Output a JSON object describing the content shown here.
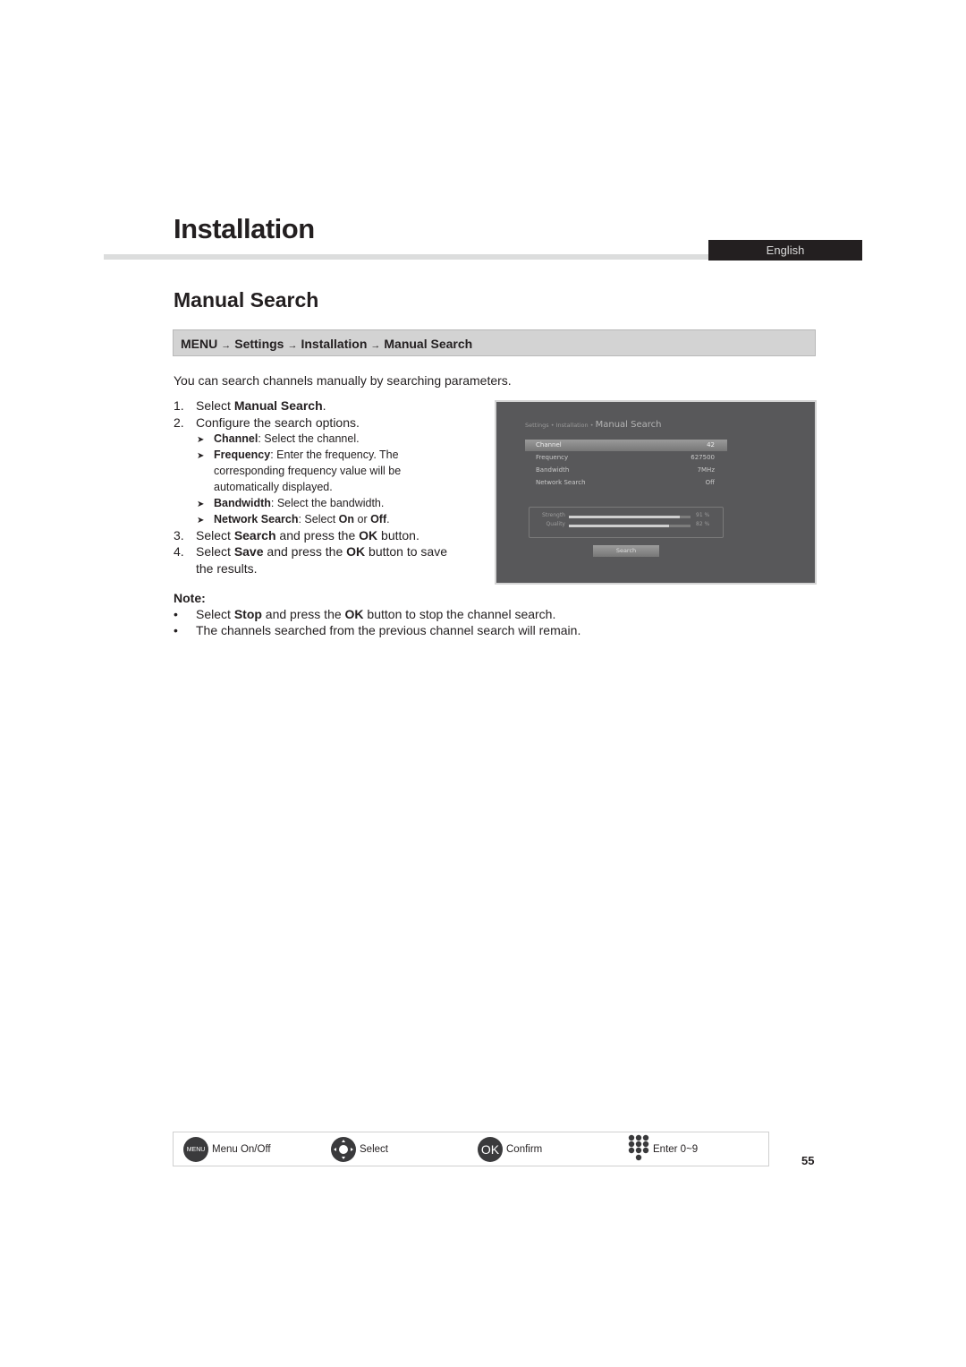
{
  "header": {
    "chapter_title": "Installation",
    "language_tab": "English"
  },
  "section": {
    "title": "Manual Search",
    "path": [
      "MENU",
      "Settings",
      "Installation",
      "Manual Search"
    ],
    "path_separator": "→",
    "intro": "You can search channels manually by searching parameters."
  },
  "steps": [
    {
      "num": "1.",
      "pre": "Select ",
      "bold": "Manual Search",
      "post": "."
    },
    {
      "num": "2.",
      "text": "Configure the search options."
    },
    {
      "num": "3.",
      "pre": "Select ",
      "bold": "Search",
      "mid": " and press the ",
      "bold2": "OK",
      "post": " button."
    },
    {
      "num": "4.",
      "pre": "Select ",
      "bold": "Save",
      "mid": " and press the ",
      "bold2": "OK",
      "post": " button to save",
      "cont": "the results."
    }
  ],
  "options": [
    {
      "bullet": "➤",
      "bold": "Channel",
      "text": ": Select the channel."
    },
    {
      "bullet": "➤",
      "bold": "Frequency",
      "text": ": Enter the frequency. The",
      "cont1": "corresponding frequency value will be",
      "cont2": "automatically displayed."
    },
    {
      "bullet": "➤",
      "bold": "Bandwidth",
      "text": ": Select the bandwidth."
    },
    {
      "bullet": "➤",
      "bold": "Network Search",
      "text": ": Select ",
      "bold2": "On",
      "mid": " or ",
      "bold3": "Off",
      "post": "."
    }
  ],
  "tv_screen": {
    "breadcrumb": "Settings • Installation •",
    "title": "Manual Search",
    "rows": [
      {
        "label": "Channel",
        "value": "42",
        "selected": true
      },
      {
        "label": "Frequency",
        "value": "627500"
      },
      {
        "label": "Bandwidth",
        "value": "7MHz"
      },
      {
        "label": "Network Search",
        "value": "Off"
      }
    ],
    "meters": [
      {
        "label": "Strength",
        "value_text": "91 %",
        "percent": 91
      },
      {
        "label": "Quality",
        "value_text": "82 %",
        "percent": 82
      }
    ],
    "button": "Search"
  },
  "note": {
    "title": "Note:",
    "items": [
      {
        "pre": "Select ",
        "bold": "Stop",
        "mid": " and press the ",
        "bold2": "OK",
        "post": " button to stop the channel search."
      },
      {
        "text": "The channels searched from the previous channel search will remain."
      }
    ]
  },
  "footer": {
    "items": [
      {
        "icon": "menu-button-icon",
        "icon_text": "MENU",
        "label": "Menu On/Off"
      },
      {
        "icon": "dpad-icon",
        "label": "Select"
      },
      {
        "icon": "ok-button-icon",
        "icon_text": "OK",
        "label": "Confirm"
      },
      {
        "icon": "numpad-icon",
        "label": "Enter 0~9"
      }
    ],
    "page_number": "55"
  }
}
